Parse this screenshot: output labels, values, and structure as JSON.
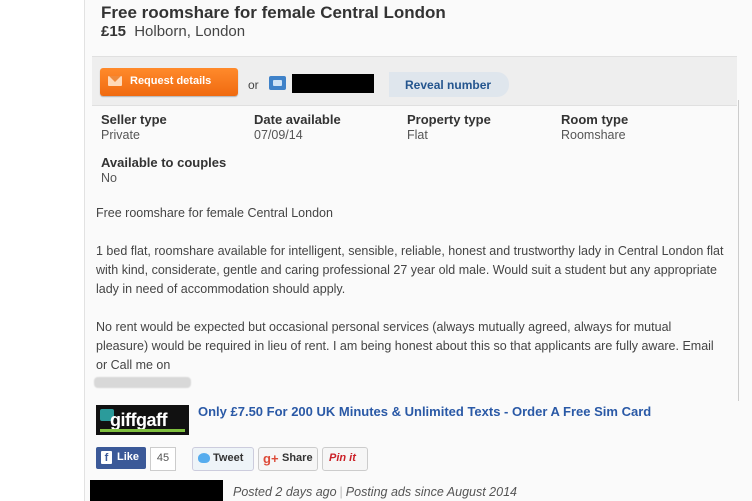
{
  "listing": {
    "title": "Free roomshare for female Central London",
    "price": "£15",
    "location": "Holborn, London"
  },
  "actions": {
    "request_label": "Request details",
    "or_label": "or",
    "reveal_label": "Reveal number"
  },
  "properties": {
    "seller_type": {
      "key": "Seller type",
      "value": "Private"
    },
    "date_available": {
      "key": "Date available",
      "value": "07/09/14"
    },
    "property_type": {
      "key": "Property type",
      "value": "Flat"
    },
    "room_type": {
      "key": "Room type",
      "value": "Roomshare"
    },
    "couples": {
      "key": "Available to couples",
      "value": "No"
    }
  },
  "description": {
    "p1": "Free roomshare for female Central London",
    "p2": "1 bed flat, roomshare available for intelligent, sensible, reliable, honest and trustworthy lady in Central London flat with kind, considerate, gentle and caring professional 27 year old male. Would suit a student but any appropriate lady in need of accommodation should apply.",
    "p3": "No rent would be expected but occasional personal services (always mutually agreed, always for mutual pleasure) would be required in lieu of rent. I am being honest about this so that applicants are fully aware. Email or Call me on"
  },
  "ad": {
    "logo_text": "giffgaff",
    "text": "Only £7.50 For 200 UK Minutes & Unlimited Texts - Order A Free Sim Card"
  },
  "social": {
    "like_label": "Like",
    "like_count": "45",
    "tweet_label": "Tweet",
    "share_label": "Share",
    "pin_label": "Pin it",
    "g_label": "g+"
  },
  "footer": {
    "posted": "Posted 2 days ago",
    "since": "Posting ads since August 2014"
  },
  "colors": {
    "accent_orange": "#f06a10",
    "link_blue": "#2a59a6",
    "reveal_blue": "#24558e"
  }
}
